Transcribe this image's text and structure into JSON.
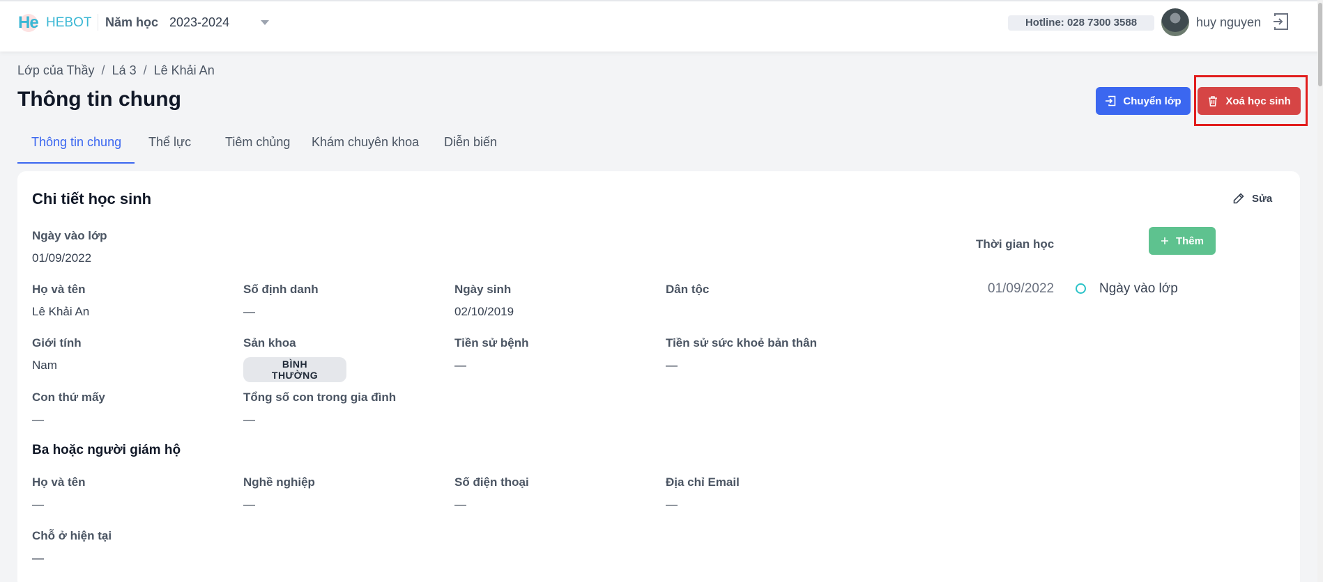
{
  "header": {
    "logo_mark": "He",
    "logo_text": "HEBOT",
    "year_label": "Năm học",
    "year_value": "2023-2024",
    "hotline": "Hotline: 028 7300 3588",
    "user_name": "huy nguyen"
  },
  "breadcrumb": {
    "items": [
      "Lớp của Thầy",
      "Lá 3",
      "Lê Khải An"
    ],
    "separator": "/"
  },
  "page": {
    "title": "Thông tin chung",
    "transfer_label": "Chuyển lớp",
    "delete_label": "Xoá học sinh"
  },
  "tabs": [
    {
      "label": "Thông tin chung",
      "active": true
    },
    {
      "label": "Thể lực",
      "active": false
    },
    {
      "label": "Tiêm chủng",
      "active": false
    },
    {
      "label": "Khám chuyên khoa",
      "active": false
    },
    {
      "label": "Diễn biến",
      "active": false
    }
  ],
  "card": {
    "title": "Chi tiết học sinh",
    "edit_label": "Sửa",
    "enroll_date": {
      "label": "Ngày vào lớp",
      "value": "01/09/2022"
    },
    "row1": [
      {
        "label": "Họ và tên",
        "value": "Lê Khải An"
      },
      {
        "label": "Số định danh",
        "value": "—"
      },
      {
        "label": "Ngày sinh",
        "value": "02/10/2019"
      },
      {
        "label": "Dân tộc",
        "value": ""
      }
    ],
    "row2": [
      {
        "label": "Giới tính",
        "value": "Nam"
      },
      {
        "label": "Sản khoa",
        "value": "BÌNH THƯỜNG"
      },
      {
        "label": "Tiền sử bệnh",
        "value": "—"
      },
      {
        "label": "Tiền sử sức khoẻ bản thân",
        "value": "—"
      }
    ],
    "row3": [
      {
        "label": "Con thứ mấy",
        "value": "—"
      },
      {
        "label": "Tổng số con trong gia đình",
        "value": "—"
      }
    ],
    "guardian_title": "Ba hoặc người giám hộ",
    "guardian": [
      {
        "label": "Họ và tên",
        "value": "—"
      },
      {
        "label": "Nghề nghiệp",
        "value": "—"
      },
      {
        "label": "Số điện thoại",
        "value": "—"
      },
      {
        "label": "Địa chỉ Email",
        "value": "—"
      }
    ],
    "residence": {
      "label": "Chỗ ở hiện tại",
      "value": "—"
    },
    "timeline": {
      "label": "Thời gian học",
      "add_label": "Thêm",
      "entry_date": "01/09/2022",
      "entry_text": "Ngày vào lớp"
    }
  },
  "colors": {
    "primary": "#3b67f0",
    "danger": "#d64545",
    "success": "#5ec28f",
    "brand": "#3ab7d4",
    "highlight": "#e11d1d"
  }
}
